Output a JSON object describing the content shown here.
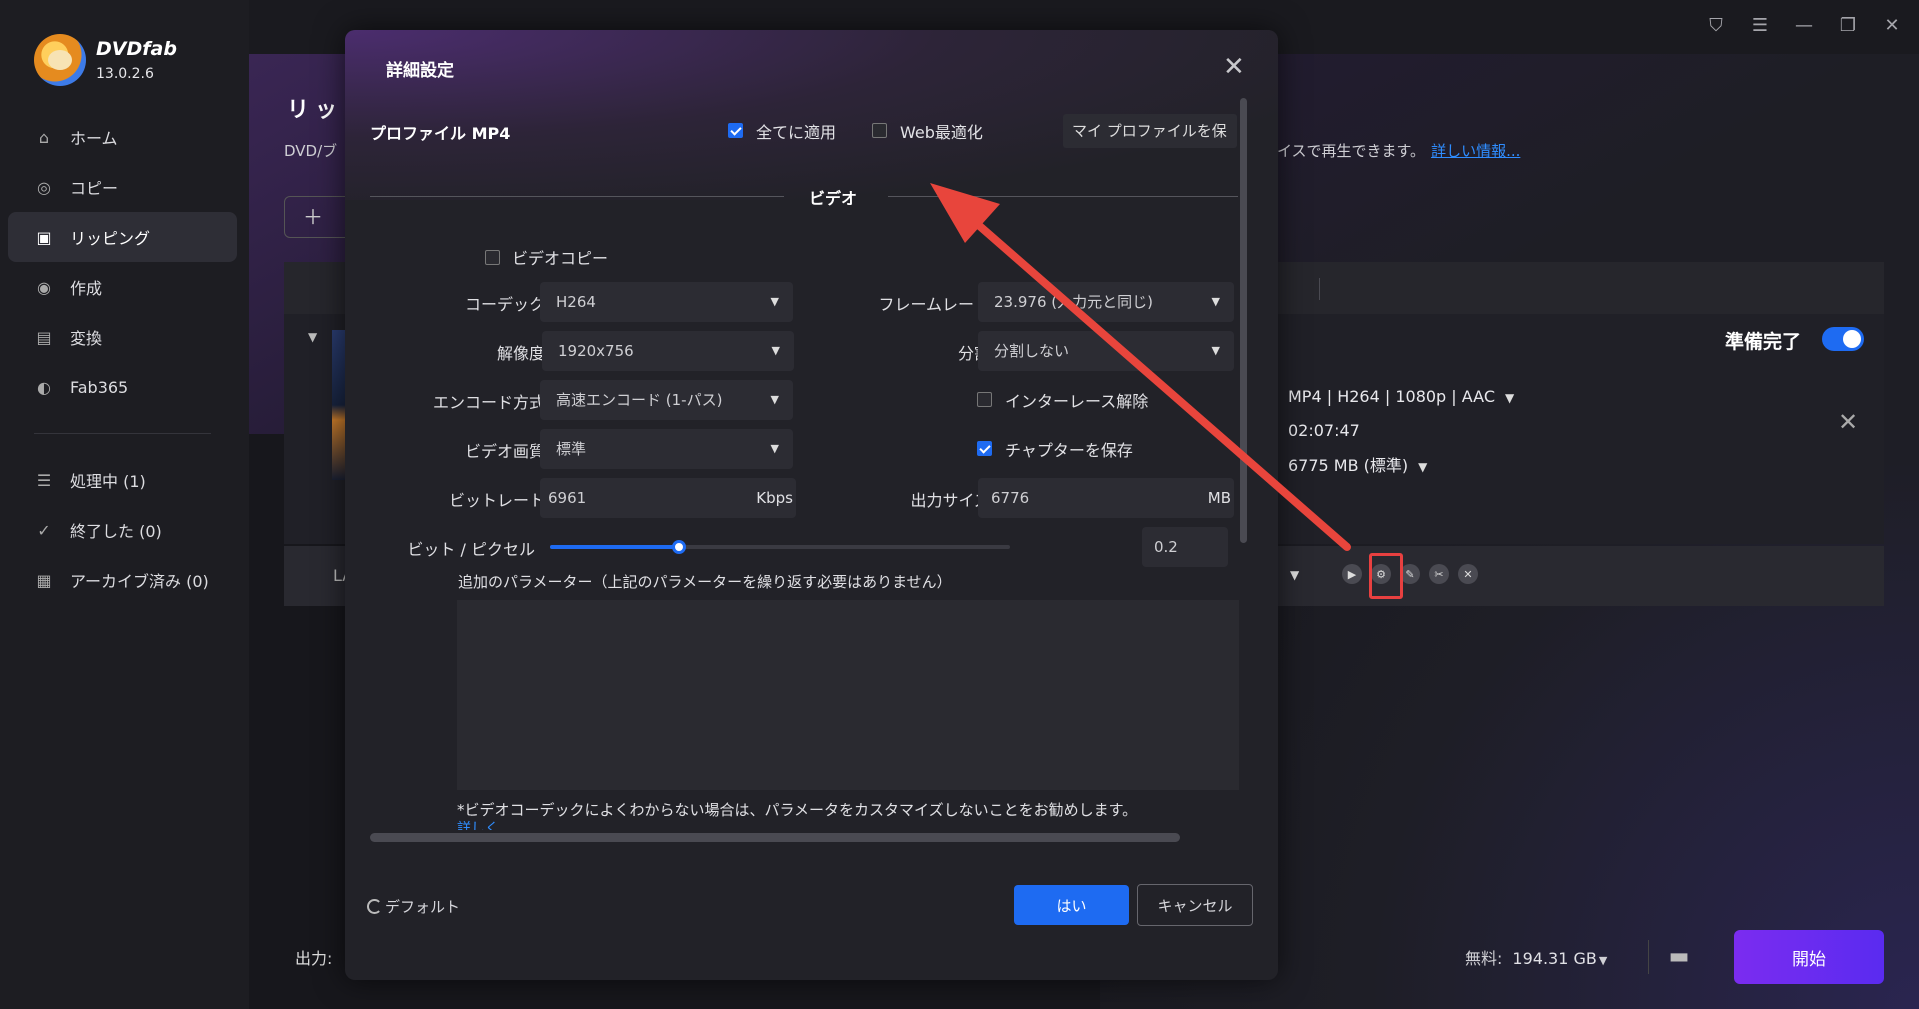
{
  "app": {
    "name": "DVDfab",
    "version": "13.0.2.6"
  },
  "sidebar": {
    "items": [
      {
        "label": "ホーム",
        "icon": "home-icon"
      },
      {
        "label": "コピー",
        "icon": "copy-icon"
      },
      {
        "label": "リッピング",
        "icon": "ripper-icon",
        "active": true
      },
      {
        "label": "作成",
        "icon": "creator-icon"
      },
      {
        "label": "変換",
        "icon": "film-icon"
      },
      {
        "label": "Fab365",
        "icon": "fab365-icon"
      }
    ],
    "queue": [
      {
        "label": "処理中 (1)",
        "icon": "list-icon"
      },
      {
        "label": "終了した (0)",
        "icon": "clipboard-check-icon"
      },
      {
        "label": "アーカイブ済み (0)",
        "icon": "archive-icon"
      }
    ]
  },
  "main": {
    "title": "リッ",
    "desc_left": "DVD/ブ",
    "desc_right": "イスで再生できます。",
    "more_link": "詳しい情報...",
    "item": {
      "status": "準備完了",
      "format": "MP4 | H264 | 1080p | AAC",
      "duration": "02:07:47",
      "size": "6775 MB (標準)",
      "name_prefix": "LA"
    },
    "output_label": "出力:",
    "free_label": "無料:",
    "free_value": "194.31 GB",
    "start_label": "開始"
  },
  "dialog": {
    "title": "詳細設定",
    "profile_label": "プロファイル MP4",
    "apply_all_label": "全てに適用",
    "apply_all_checked": true,
    "web_opt_label": "Web最適化",
    "web_opt_checked": false,
    "save_profile_label": "マイ プロファイルを保",
    "section_video": "ビデオ",
    "video_copy_label": "ビデオコピー",
    "video_copy_checked": false,
    "codec_label": "コーデック",
    "codec_value": "H264",
    "framerate_label": "フレームレート",
    "framerate_value": "23.976 (入力元と同じ)",
    "resolution_label": "解像度",
    "resolution_value": "1920x756",
    "split_label": "分割",
    "split_value": "分割しない",
    "encode_label": "エンコード方式",
    "encode_value": "高速エンコード (1-パス)",
    "deinterlace_label": "インターレース解除",
    "deinterlace_checked": false,
    "quality_label": "ビデオ画質",
    "quality_value": "標準",
    "chapter_label": "チャプターを保存",
    "chapter_checked": true,
    "bitrate_label": "ビットレート",
    "bitrate_value": "6961",
    "bitrate_unit": "Kbps",
    "outsize_label": "出力サイズ",
    "outsize_value": "6776",
    "outsize_unit": "MB",
    "bpp_label": "ビット / ピクセル",
    "bpp_value": "0.2",
    "bpp_slider_fraction": 0.28,
    "param_label": "追加のパラメーター（上記のパラメーターを繰り返す必要はありません）",
    "note": "*ビデオコーデックによくわからない場合は、パラメータをカスタマイズしないことをお勧めします。",
    "detail_link": "詳しく",
    "default_label": "デフォルト",
    "ok_label": "はい",
    "cancel_label": "キャンセル"
  },
  "colors": {
    "accent": "#1e6bf2",
    "start": "#7b2cf0",
    "highlight": "#e84040"
  }
}
